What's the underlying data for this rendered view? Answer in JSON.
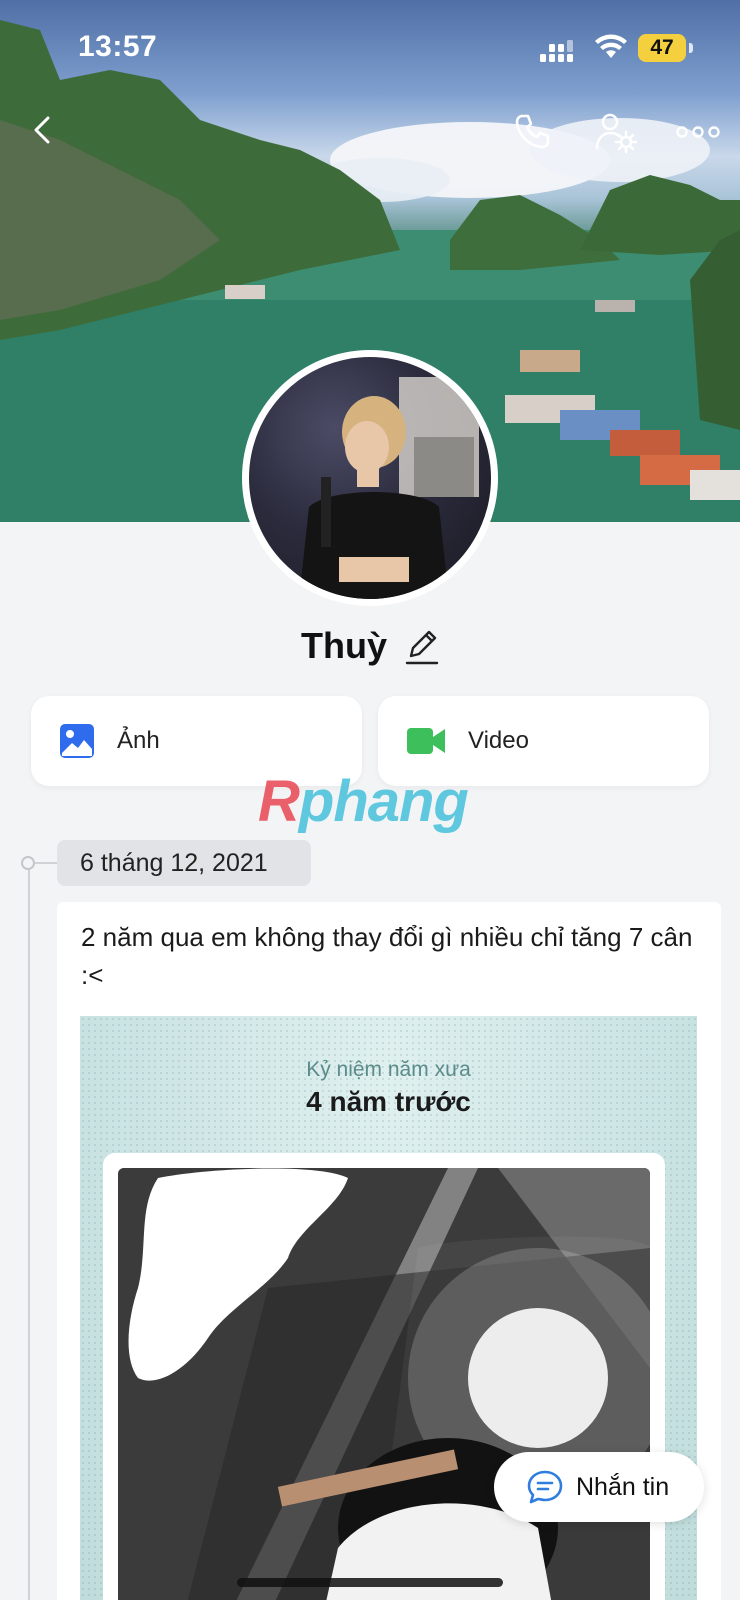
{
  "status_bar": {
    "time": "13:57",
    "battery": "47"
  },
  "profile": {
    "name": "Thuỳ"
  },
  "actions": {
    "photo_label": "Ảnh",
    "video_label": "Video"
  },
  "watermark": {
    "first": "R",
    "rest": "phang"
  },
  "timeline": {
    "date": "6 tháng 12, 2021"
  },
  "post": {
    "text": "2 năm qua em không thay đổi gì nhiều chỉ tăng 7 cân :<",
    "memory_subtitle": "Kỷ niệm năm xưa",
    "memory_title": "4 năm trước"
  },
  "floating": {
    "message_label": "Nhắn tin"
  },
  "colors": {
    "photo_icon": "#2f6bed",
    "video_icon": "#3dbf5b",
    "message_icon": "#2f7dde",
    "battery": "#f4d03f"
  }
}
